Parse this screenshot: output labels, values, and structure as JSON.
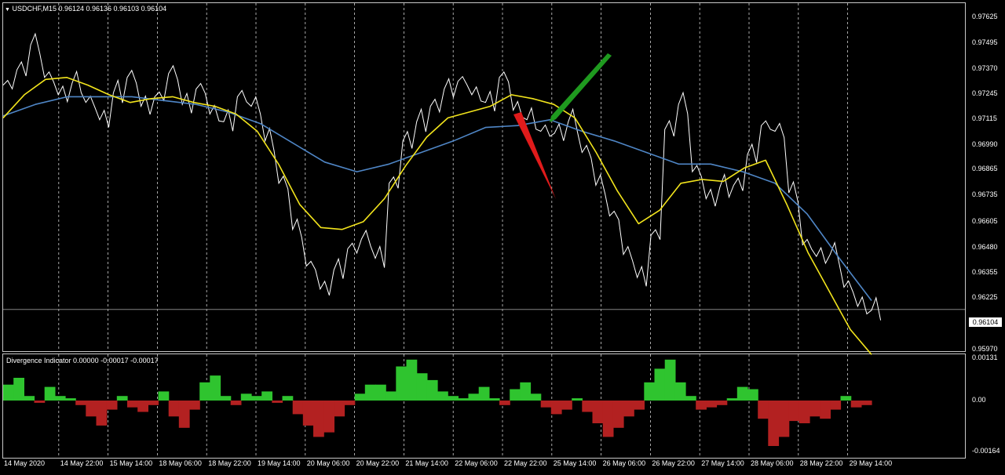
{
  "main_pane": {
    "symbol_label": "USDCHF,M15",
    "ohlc": "0.96124 0.96136 0.96103 0.96104",
    "menu_icon": "triangle-down-icon",
    "price_ticks": [
      "0.97625",
      "0.97495",
      "0.97370",
      "0.97245",
      "0.97115",
      "0.96990",
      "0.96865",
      "0.96735",
      "0.96605",
      "0.96480",
      "0.96355",
      "0.96225",
      "0.95970"
    ],
    "current_price": "0.96104"
  },
  "indicator_pane": {
    "label": "Divergence Indicator 0.00000 -0.00017 -0.00017",
    "ticks": [
      "0.00131",
      "0.00",
      "-0.00164"
    ]
  },
  "time_axis": {
    "labels": [
      "14 May 2020",
      "14 May 22:00",
      "15 May 14:00",
      "18 May 06:00",
      "18 May 22:00",
      "19 May 14:00",
      "20 May 06:00",
      "20 May 22:00",
      "21 May 14:00",
      "22 May 06:00",
      "22 May 22:00",
      "25 May 14:00",
      "26 May 06:00",
      "26 May 22:00",
      "27 May 14:00",
      "28 May 06:00",
      "28 May 22:00",
      "29 May 14:00"
    ]
  },
  "colors": {
    "background": "#000000",
    "price_line": "#ffffff",
    "fast_ma": "#f2e41c",
    "slow_ma": "#4f86c6",
    "hist_positive": "#2fc42f",
    "hist_negative": "#b32121",
    "arrow_red": "#e01b1b",
    "arrow_green": "#1f9a1f",
    "grid": "#cfcfcf"
  },
  "chart_data": {
    "type": "line",
    "series": [
      {
        "values": [
          0.9727,
          0.9735,
          0.9748,
          0.9731,
          0.9722,
          0.9728,
          0.9718,
          0.9709,
          0.9723,
          0.9731,
          0.9716,
          0.9721,
          0.9733,
          0.9717,
          0.9725,
          0.9712,
          0.9708,
          0.9721,
          0.9716,
          0.9698,
          0.9676,
          0.9652,
          0.9633,
          0.9621,
          0.9631,
          0.9642,
          0.9647,
          0.9637,
          0.9676,
          0.9698,
          0.9708,
          0.9716,
          0.9725,
          0.9729,
          0.9722,
          0.9718,
          0.9731,
          0.9714,
          0.9709,
          0.9703,
          0.9702,
          0.9708,
          0.9692,
          0.9675,
          0.9659,
          0.9639,
          0.9627,
          0.9649,
          0.9704,
          0.9717,
          0.9682,
          0.9668,
          0.9674,
          0.9675,
          0.9691,
          0.9706,
          0.9703,
          0.9671,
          0.9644,
          0.9638,
          0.9639,
          0.9622,
          0.9612,
          0.961
        ]
      },
      {
        "values": [
          0.971,
          0.9722,
          0.973,
          0.9731,
          0.9727,
          0.9722,
          0.9718,
          0.972,
          0.9721,
          0.9718,
          0.9716,
          0.9712,
          0.9703,
          0.9686,
          0.9665,
          0.9653,
          0.9652,
          0.9656,
          0.9668,
          0.9685,
          0.97,
          0.971,
          0.9713,
          0.9716,
          0.9722,
          0.972,
          0.9717,
          0.971,
          0.9692,
          0.9672,
          0.9655,
          0.9662,
          0.9676,
          0.9678,
          0.9677,
          0.9684,
          0.9688,
          0.9665,
          0.964,
          0.962,
          0.96,
          0.9587
        ]
      },
      {
        "values": [
          0.9711,
          0.9717,
          0.9721,
          0.9721,
          0.9721,
          0.9719,
          0.9717,
          0.9713,
          0.9707,
          0.9697,
          0.9687,
          0.9682,
          0.9686,
          0.9692,
          0.9698,
          0.9705,
          0.9706,
          0.9709,
          0.9703,
          0.9698,
          0.9692,
          0.9686,
          0.9686,
          0.9682,
          0.9676,
          0.966,
          0.9637,
          0.9615
        ]
      }
    ]
  }
}
